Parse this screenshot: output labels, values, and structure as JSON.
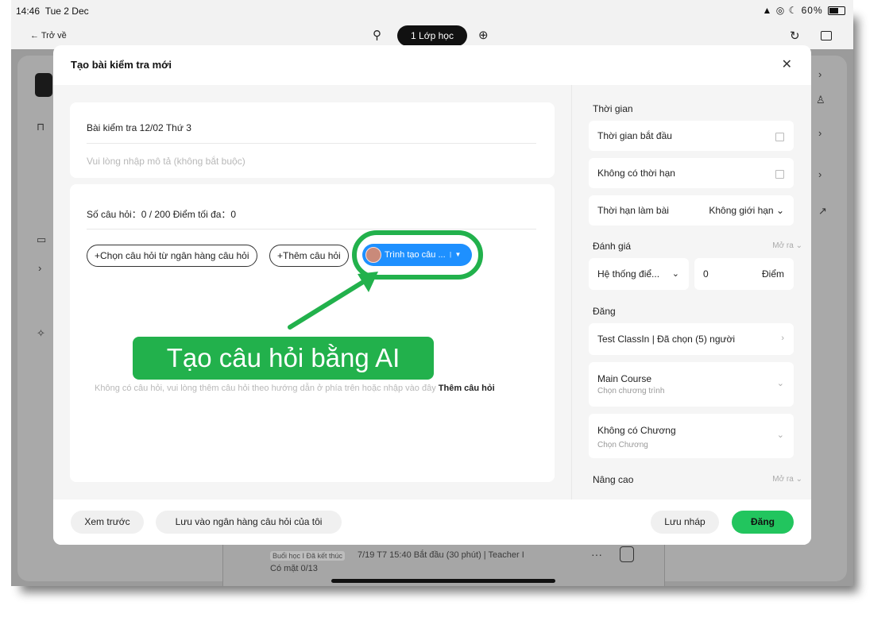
{
  "status": {
    "time": "14:46",
    "date": "Tue 2 Dec",
    "battery": "60%"
  },
  "topbar": {
    "back": "Trở về",
    "class_pill": "1 Lớp học"
  },
  "modal": {
    "title": "Tạo bài kiểm tra mới",
    "test_title": "Bài kiểm tra 12/02 Thứ 3",
    "description_placeholder": "Vui lòng nhập mô tả (không bắt buộc)",
    "stats": "Số câu hỏi：0 / 200   Điểm tối đa：0",
    "btn_bank": "+Chọn câu hỏi từ ngân hàng câu hỏi",
    "btn_add": "+Thêm câu hỏi",
    "btn_ai": "Trình tạo câu ...",
    "empty_text": "Không có câu hỏi, vui lòng thêm câu hỏi theo hướng dẫn ở phía trên hoặc nhập vào đây",
    "empty_link": "Thêm câu hỏi"
  },
  "right": {
    "time_header": "Thời gian",
    "start_time": "Thời gian bắt đầu",
    "no_deadline": "Không có thời hạn",
    "duration_label": "Thời hạn làm bài",
    "duration_value": "Không giới hạn",
    "grading_header": "Đánh giá",
    "expand": "Mở ra",
    "grading_system": "Hệ thống điể...",
    "score_value": "0",
    "score_unit": "Điểm",
    "publish_header": "Đăng",
    "publish_target": "Test ClassIn | Đã chọn (5) người",
    "course_title": "Main Course",
    "course_sub": "Chọn chương trình",
    "chapter_title": "Không có Chương",
    "chapter_sub": "Chọn Chương",
    "advanced_header": "Nâng cao"
  },
  "footer": {
    "preview": "Xem trước",
    "save_bank": "Lưu vào ngân hàng câu hỏi của tôi",
    "save_draft": "Lưu nháp",
    "publish": "Đăng"
  },
  "background": {
    "lesson_tag": "Buổi học I Đã kết thúc",
    "lesson_info": "7/19 T7 15:40 Bắt đầu (30 phút)  |  Teacher  I",
    "attendance": "Có mặt  0/13"
  },
  "callout": {
    "text": "Tạo câu hỏi bằng AI"
  },
  "colors": {
    "accent_blue": "#1e90ff",
    "green": "#22b14c",
    "publish_green": "#22c55e"
  }
}
